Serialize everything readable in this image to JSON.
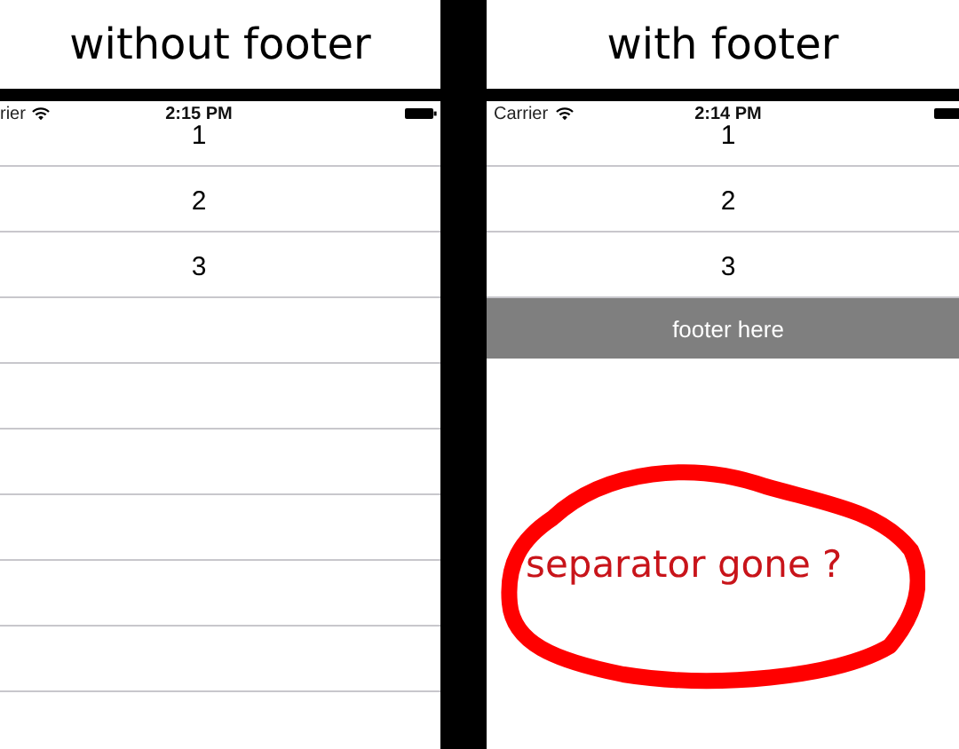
{
  "panels": [
    {
      "title": "without footer",
      "status_bar": {
        "carrier": "rier",
        "time": "2:15 PM"
      },
      "rows": [
        "1",
        "2",
        "3"
      ]
    },
    {
      "title": "with footer",
      "status_bar": {
        "carrier": "Carrier",
        "time": "2:14 PM"
      },
      "rows": [
        "1",
        "2",
        "3"
      ],
      "footer": "footer here",
      "annotation": {
        "text": "separator gone ?"
      }
    }
  ]
}
